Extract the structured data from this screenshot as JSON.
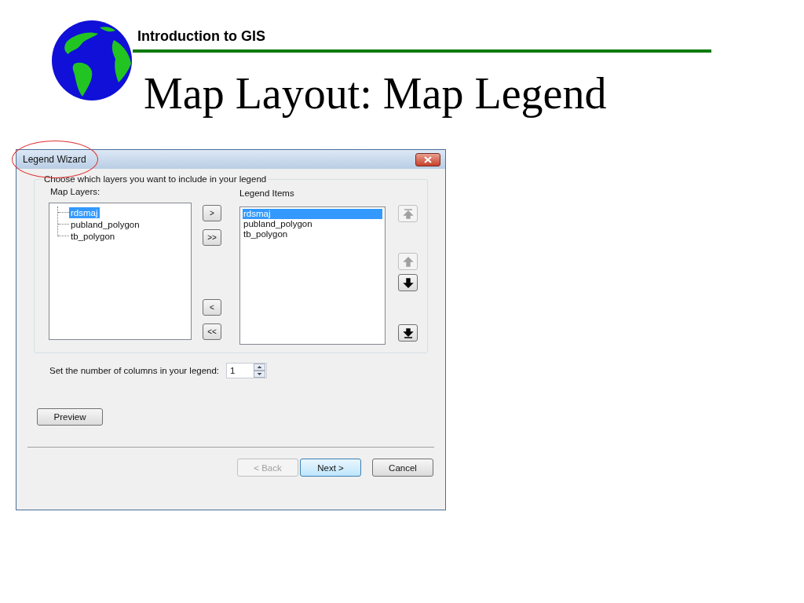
{
  "slide": {
    "header": "Introduction to GIS",
    "title": "Map Layout: Map Legend"
  },
  "dialog": {
    "title": "Legend Wizard",
    "title_circled": true,
    "group_label": "Choose which layers you want to include in your legend",
    "map_layers": {
      "label": "Map Layers:",
      "items": [
        {
          "label": "rdsmaj",
          "selected": true
        },
        {
          "label": "publand_polygon",
          "selected": false
        },
        {
          "label": "tb_polygon",
          "selected": false
        }
      ]
    },
    "add_buttons": [
      {
        "label": ">"
      },
      {
        "label": ">>"
      }
    ],
    "remove_buttons": [
      {
        "label": "<"
      },
      {
        "label": "<<"
      }
    ],
    "legend_items": {
      "label": "Legend Items",
      "items": [
        {
          "label": "rdsmaj",
          "selected": true
        },
        {
          "label": "publand_polygon",
          "selected": false
        },
        {
          "label": "tb_polygon",
          "selected": false
        }
      ]
    },
    "order_buttons": [
      {
        "kind": "top",
        "disabled": true
      },
      {
        "kind": "up",
        "disabled": true
      },
      {
        "kind": "down",
        "disabled": false
      },
      {
        "kind": "bottom",
        "disabled": false
      }
    ],
    "columns": {
      "label": "Set the number of columns in your legend:",
      "value": "1"
    },
    "preview_button": "Preview",
    "nav_buttons": [
      {
        "label": "< Back",
        "disabled": true,
        "default": false
      },
      {
        "label": "Next >",
        "disabled": false,
        "default": true
      },
      {
        "label": "Cancel",
        "disabled": false,
        "default": false
      }
    ]
  }
}
